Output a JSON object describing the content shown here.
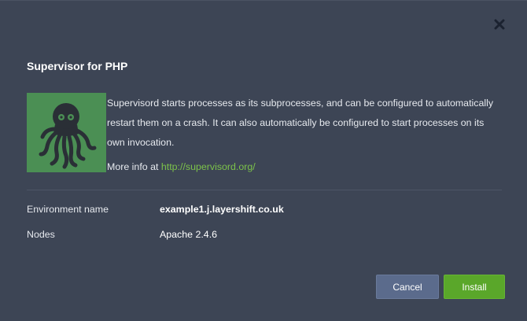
{
  "dialog": {
    "close_icon": "close-icon",
    "title": "Supervisor for PHP",
    "logo_icon": "supervisor-octopus-logo",
    "logo_color": "#4b8f54",
    "description": "Supervisord starts processes as its subprocesses, and can be configured to automatically restart them on a crash. It can also automatically be configured to start processes on its own invocation.",
    "more_info_prefix": "More info at",
    "more_info_link": "http://supervisord.org/",
    "link_color": "#7cc24a",
    "environment_label": "Environment name",
    "environment_value": "example1.j.layershift.co.uk",
    "nodes_label": "Nodes",
    "nodes_value": "Apache 2.4.6",
    "cancel_label": "Cancel",
    "install_label": "Install",
    "cancel_color": "#5b6b8c",
    "install_color": "#5aa72a"
  }
}
